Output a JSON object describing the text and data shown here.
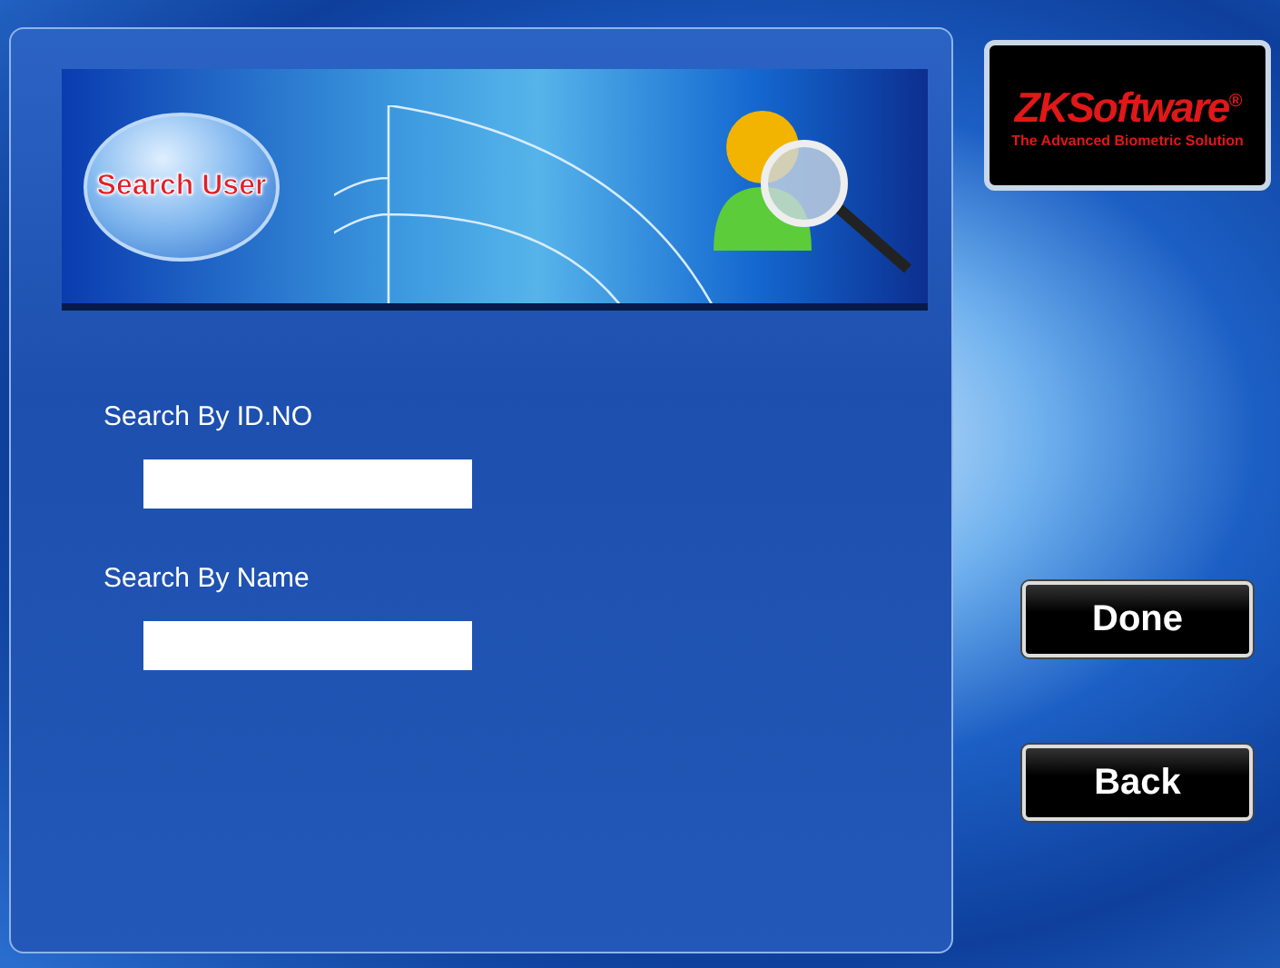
{
  "banner": {
    "title": "Search User"
  },
  "logo": {
    "brand": "ZKSoftware",
    "mark": "®",
    "tagline": "The Advanced Biometric Solution"
  },
  "fields": [
    {
      "label": "Search By ID.NO"
    },
    {
      "label": "Search By Name"
    }
  ],
  "buttons": [
    "Done",
    "Back"
  ]
}
